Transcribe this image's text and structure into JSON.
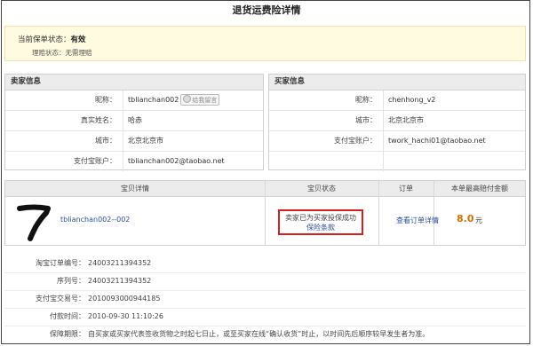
{
  "title": "退货运费险详情",
  "status": {
    "label": "当前保单状态：",
    "value": "有效",
    "claim_label": "理赔状态：",
    "claim_value": "无需理赔"
  },
  "seller": {
    "header": "卖家信息",
    "rows": [
      {
        "label": "昵称：",
        "value": "tblianchan002",
        "tag": "给我留言"
      },
      {
        "label": "真实姓名：",
        "value": "哈赤"
      },
      {
        "label": "城市：",
        "value": "北京北京市"
      },
      {
        "label": "支付宝账户：",
        "value": "tblianchan002@taobao.net"
      }
    ]
  },
  "buyer": {
    "header": "买家信息",
    "rows": [
      {
        "label": "昵称：",
        "value": "chenhong_v2"
      },
      {
        "label": "城市：",
        "value": "北京北京市"
      },
      {
        "label": "支付宝账户：",
        "value": "twork_hachi01@taobao.net"
      },
      {
        "label": "",
        "value": ""
      }
    ]
  },
  "goods": {
    "columns": [
      "宝贝详情",
      "宝贝状态",
      "订单",
      "本单最高赔付金额"
    ],
    "item_name": "tblianchan002--002",
    "status_text": "卖家已为买家投保成功",
    "status_link": "保险条款",
    "order_link": "查看订单详情",
    "amount": "8.0",
    "unit": "元"
  },
  "details": [
    {
      "label": "淘宝订单编号：",
      "value": "24003211394352"
    },
    {
      "label": "序列号：",
      "value": "24003211394352"
    },
    {
      "label": "支付宝交易号：",
      "value": "2010093000944185"
    },
    {
      "label": "付款时间：",
      "value": "2010-09-30 11:10:26"
    },
    {
      "label": "保障期限：",
      "value": "自买家或买家代表签收货物之时起七日止，或至买家在线“确认收货”时止，以时间先后顺序较早发生者为准。"
    }
  ],
  "colors": {
    "accent_link": "#2a4d9a",
    "amount": "#d86e00",
    "highlight_box": "#d42020",
    "status_bg": "#fffbe0"
  }
}
